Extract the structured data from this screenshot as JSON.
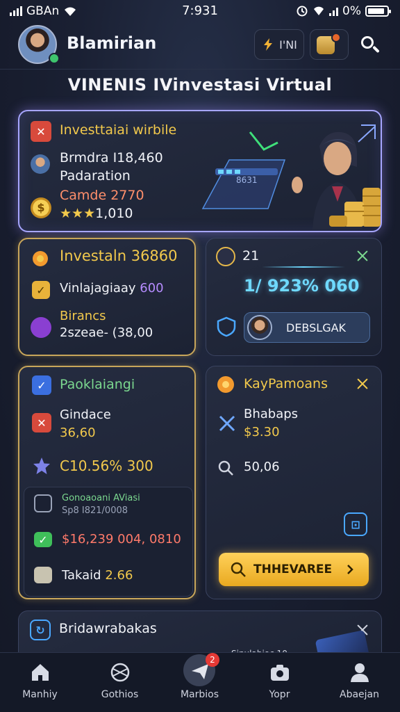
{
  "status_bar": {
    "carrier": "GBAn",
    "time": "7:931",
    "battery": "0%",
    "battery_level": 0.9
  },
  "header": {
    "username": "Blamirian",
    "pill_label": "I'NI"
  },
  "page_title": "VINENIS IVinvestasi Virtual",
  "hero": {
    "title": "Investtaiai wirbile",
    "line1": "Brmdra I18,460",
    "line2": "Padaration",
    "line3": "Camde 2770",
    "line4_stars": "★★★",
    "line4_value": "1,010",
    "panel_text": "8631"
  },
  "card_invest": {
    "title": "Investaln 36860",
    "row1": "Vinlajagiaay",
    "row1_value": "600",
    "row2_title": "Birancs",
    "row2_value": "2szeae- (38,00"
  },
  "card_stats": {
    "label": "21",
    "value": "1/ 923% 060",
    "button_label": "DEBSLGAK"
  },
  "card_packaging": {
    "title": "Paoklaiangi",
    "row1_title": "Gindace",
    "row1_value": "36,60",
    "row2_value": "C10.56% 300",
    "sub_title": "Gonoaoani AViasi",
    "sub_value": "Sp8 I821/0008",
    "sub_row1": "$16,239 004, 0810",
    "sub_row2_label": "Takaid",
    "sub_row2_value": "2.66"
  },
  "card_payments": {
    "title": "KayPamoans",
    "row1_title": "Bhabaps",
    "row1_value": "$3.30",
    "row2_value": "50,06",
    "cta_label": "THHEVAREE"
  },
  "card_bottom": {
    "title": "Bridawrabakas",
    "peek_text": "Sinulabioc 10"
  },
  "bottom_nav": [
    {
      "label": "Manhiy",
      "icon": "home-icon"
    },
    {
      "label": "Gothios",
      "icon": "globe-icon"
    },
    {
      "label": "Marbios",
      "icon": "plane-icon",
      "badge": "2"
    },
    {
      "label": "Yopr",
      "icon": "camera-icon"
    },
    {
      "label": "Abaejan",
      "icon": "person-icon"
    }
  ],
  "colors": {
    "accent_gold": "#f2c94c",
    "accent_cyan": "#6fd9ff",
    "accent_green": "#7bd88f",
    "bg": "#1a2033"
  }
}
